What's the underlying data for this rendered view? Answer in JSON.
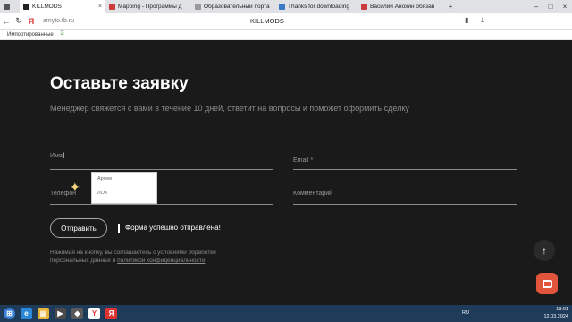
{
  "browser": {
    "tabs": [
      {
        "label": "",
        "color": "#555555",
        "active": false
      },
      {
        "label": "KILLMODS",
        "color": "#222222",
        "active": true
      },
      {
        "label": "Mapping - Программы д",
        "color": "#cc3b3b",
        "active": false
      },
      {
        "label": "Образовательный порта",
        "color": "#9a9a9a",
        "active": false
      },
      {
        "label": "Thanks for downloading",
        "color": "#3b7ac7",
        "active": false
      },
      {
        "label": "Василий Анохин обязав",
        "color": "#cc3b3b",
        "active": false
      }
    ],
    "url": "amyto.tb.ru",
    "page_title": "KILLMODS",
    "bookmark": "Импортированные"
  },
  "form": {
    "title": "Оставьте заявку",
    "subtitle": "Менеджер свяжется с вами в течение 10 дней, ответит на вопросы и поможет оформить сделку",
    "name_label": "Имя",
    "email_label": "Email *",
    "phone_label": "Телефон",
    "comment_label": "Комментарий",
    "autocomplete": [
      "Артем",
      "ЛОХ"
    ],
    "submit_label": "Отправить",
    "success_message": "Форма успешно отправлена!",
    "consent_text": "Нажимая на кнопку, вы соглашаетесь с условиями обработки персональных данных и",
    "consent_link": "политикой конфиденциальности"
  },
  "taskbar": {
    "lang": "RU",
    "time": "13:01",
    "date": "12.03.2024"
  }
}
